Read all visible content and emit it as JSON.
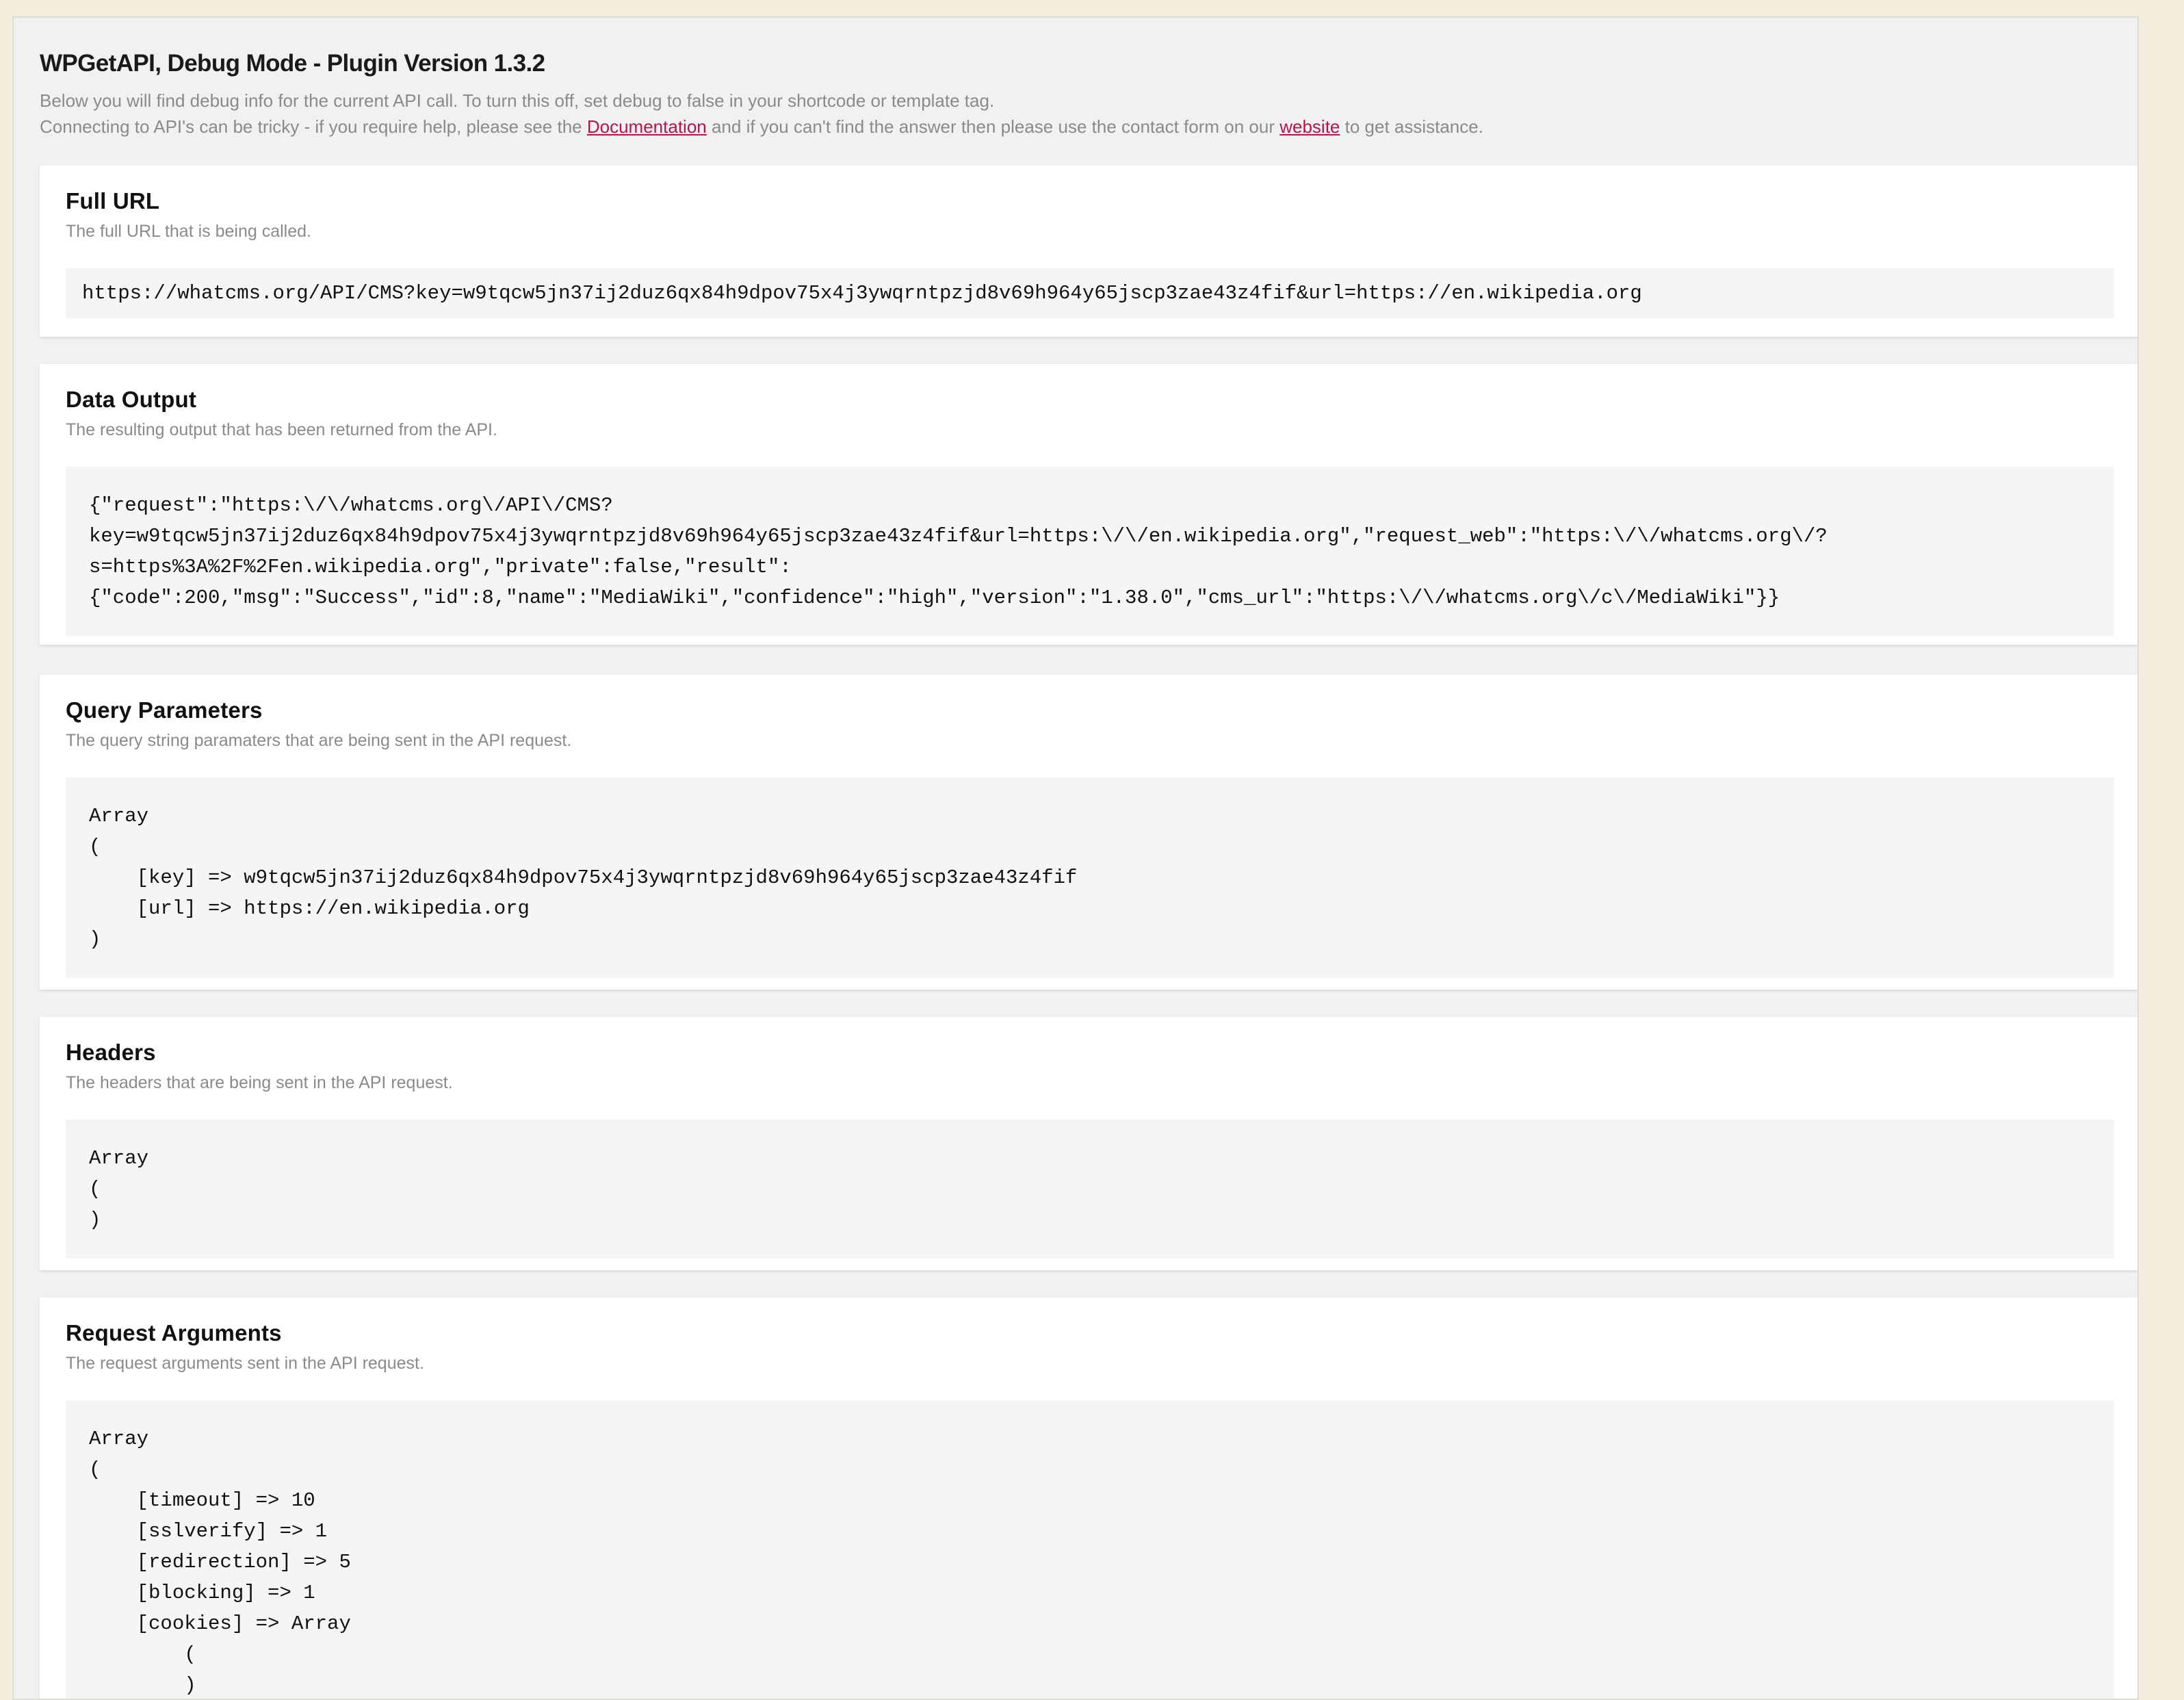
{
  "header": {
    "title": "WPGetAPI, Debug Mode - Plugin Version 1.3.2",
    "line1": "Below you will find debug info for the current API call. To turn this off, set debug to false in your shortcode or template tag.",
    "line2_before": "Connecting to API's can be tricky - if you require help, please see the ",
    "documentation_link": "Documentation",
    "line2_middle": " and if you can't find the answer then please use the contact form on our ",
    "website_link": "website",
    "line2_after": " to get assistance."
  },
  "sections": {
    "full_url": {
      "title": "Full URL",
      "description": "The full URL that is being called.",
      "value": "https://whatcms.org/API/CMS?key=w9tqcw5jn37ij2duz6qx84h9dpov75x4j3ywqrntpzjd8v69h964y65jscp3zae43z4fif&url=https://en.wikipedia.org"
    },
    "data_output": {
      "title": "Data Output",
      "description": "The resulting output that has been returned from the API.",
      "value": "{\"request\":\"https:\\/\\/whatcms.org\\/API\\/CMS?\nkey=w9tqcw5jn37ij2duz6qx84h9dpov75x4j3ywqrntpzjd8v69h964y65jscp3zae43z4fif&url=https:\\/\\/en.wikipedia.org\",\"request_web\":\"https:\\/\\/whatcms.org\\/?\ns=https%3A%2F%2Fen.wikipedia.org\",\"private\":false,\"result\":\n{\"code\":200,\"msg\":\"Success\",\"id\":8,\"name\":\"MediaWiki\",\"confidence\":\"high\",\"version\":\"1.38.0\",\"cms_url\":\"https:\\/\\/whatcms.org\\/c\\/MediaWiki\"}}"
    },
    "query_parameters": {
      "title": "Query Parameters",
      "description": "The query string paramaters that are being sent in the API request.",
      "value": "Array\n(\n    [key] => w9tqcw5jn37ij2duz6qx84h9dpov75x4j3ywqrntpzjd8v69h964y65jscp3zae43z4fif\n    [url] => https://en.wikipedia.org\n)"
    },
    "headers": {
      "title": "Headers",
      "description": "The headers that are being sent in the API request.",
      "value": "Array\n(\n)"
    },
    "request_arguments": {
      "title": "Request Arguments",
      "description": "The request arguments sent in the API request.",
      "value": "Array\n(\n    [timeout] => 10\n    [sslverify] => 1\n    [redirection] => 5\n    [blocking] => 1\n    [cookies] => Array\n        (\n        )"
    }
  }
}
